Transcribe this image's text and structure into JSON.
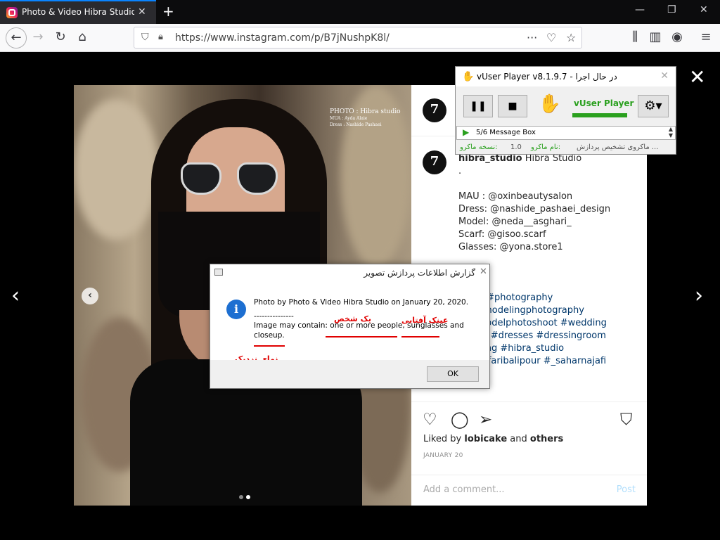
{
  "browser": {
    "tab_title": "Photo & Video Hibra Studio (@",
    "tab_close": "✕",
    "new_tab": "+",
    "url": "https://www.instagram.com/p/B7jNushpK8l/",
    "window_min": "—",
    "window_max": "❐",
    "window_close": "✕"
  },
  "photo_credit": {
    "line1": "PHOTO : Hibra studio",
    "line2": "MUA : Ayda Alaie",
    "line3": "Dress : Nashide Pashaei"
  },
  "post": {
    "username": "hibra_studio",
    "fullname": "Hibra Studio",
    "caption_lines": [
      ".",
      "",
      "MAU : @oxinbeautysalon",
      "Dress: @nashide_pashaei_design",
      "Model: @neda__asghari_",
      "Scarf: @gisoo.scarf",
      "Glasses: @yona.store1",
      "",
      ".",
      "",
      "shoot #photography",
      "ing #modelingphotography",
      "el #modelphotoshoot #wedding",
      "nghair #dresses #dressingroom",
      "wedding #hibra_studio",
      "aeiji #faribalipour #_saharnajafi"
    ],
    "liked_by_prefix": "Liked by",
    "liked_by_user": "lobicake",
    "liked_by_and": "and",
    "liked_by_others": "others",
    "date": "JANUARY 20",
    "comment_placeholder": "Add a comment...",
    "post_button": "Post"
  },
  "vuser": {
    "title": "vUser Player v8.1.9.7 - در حال اجرا",
    "logo_text": "vUser Player",
    "pause": "❚❚",
    "stop": "■",
    "gear": "⚙▾",
    "status_step": "5/6 Message Box",
    "footer_version_label": "نسخه ماکرو:",
    "footer_version": "1.0",
    "footer_name_label": "نام ماکرو:",
    "footer_name": "ماکروی تشخیص پردازش ..."
  },
  "dialog": {
    "title": "گزارش اطلاعات پردازش تصویر",
    "info_icon": "i",
    "line1": "Photo by Photo & Video Hibra  Studio on January 20, 2020.",
    "line2": "---------------",
    "line3": "Image may contain: one or more people, sunglasses and",
    "line4": "closeup.",
    "ok": "OK"
  },
  "annotations": {
    "people": "یک شخص",
    "sunglasses": "عینک آفتابی",
    "closeup": "نمای نزدیک",
    "color": "#e00000"
  }
}
